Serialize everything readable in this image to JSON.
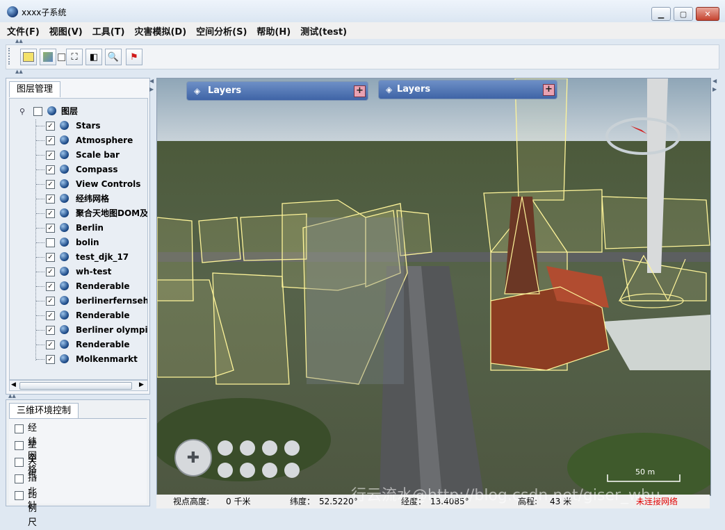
{
  "window": {
    "title": "xxxx子系统"
  },
  "menu": [
    "文件(F)",
    "视图(V)",
    "工具(T)",
    "灾害模拟(D)",
    "空间分析(S)",
    "帮助(H)",
    "测试(test)"
  ],
  "toolbar": {
    "buttons": [
      "select-icon",
      "map-icon",
      "checkbox-icon",
      "binoculars-icon",
      "export-icon",
      "zoom-icon",
      "flag-icon"
    ]
  },
  "layer_panel": {
    "tab": "图层管理",
    "root": {
      "label": "图层",
      "checked": false
    },
    "items": [
      {
        "label": "Stars",
        "checked": true
      },
      {
        "label": "Atmosphere",
        "checked": true
      },
      {
        "label": "Scale bar",
        "checked": true
      },
      {
        "label": "Compass",
        "checked": true
      },
      {
        "label": "View Controls",
        "checked": true
      },
      {
        "label": "经纬网格",
        "checked": true
      },
      {
        "label": "聚合天地图DOM及",
        "checked": true
      },
      {
        "label": "Berlin",
        "checked": true
      },
      {
        "label": "bolin",
        "checked": false
      },
      {
        "label": "test_djk_17",
        "checked": true
      },
      {
        "label": "wh-test",
        "checked": true
      },
      {
        "label": "Renderable",
        "checked": true
      },
      {
        "label": "berlinerfernsehtu",
        "checked": true
      },
      {
        "label": "Renderable",
        "checked": true
      },
      {
        "label": "Berliner olympias",
        "checked": true
      },
      {
        "label": "Renderable",
        "checked": true
      },
      {
        "label": "Molkenmarkt",
        "checked": true
      }
    ]
  },
  "env_panel": {
    "tab": "三维环境控制",
    "items": [
      "经纬网格",
      "星空",
      "大气",
      "指北针",
      "比例尺"
    ]
  },
  "map": {
    "layers_button_1": "Layers",
    "layers_button_2": "Layers",
    "scale_label": "50 m"
  },
  "status": {
    "view_height_label": "视点高度:",
    "view_height_value": "0 千米",
    "lat_label": "纬度：",
    "lat_value": "52.5220°",
    "lon_label": "经度：",
    "lon_value": "13.4085°",
    "elev_label": "高程:",
    "elev_value": "43 米",
    "connection": "未连接网络"
  },
  "watermark": "行云流水@http://blog.csdn.net/giser_whu",
  "colors": {
    "accent": "#3f64a6",
    "wireframe": "#fff59a",
    "status_warn": "#e00000"
  }
}
